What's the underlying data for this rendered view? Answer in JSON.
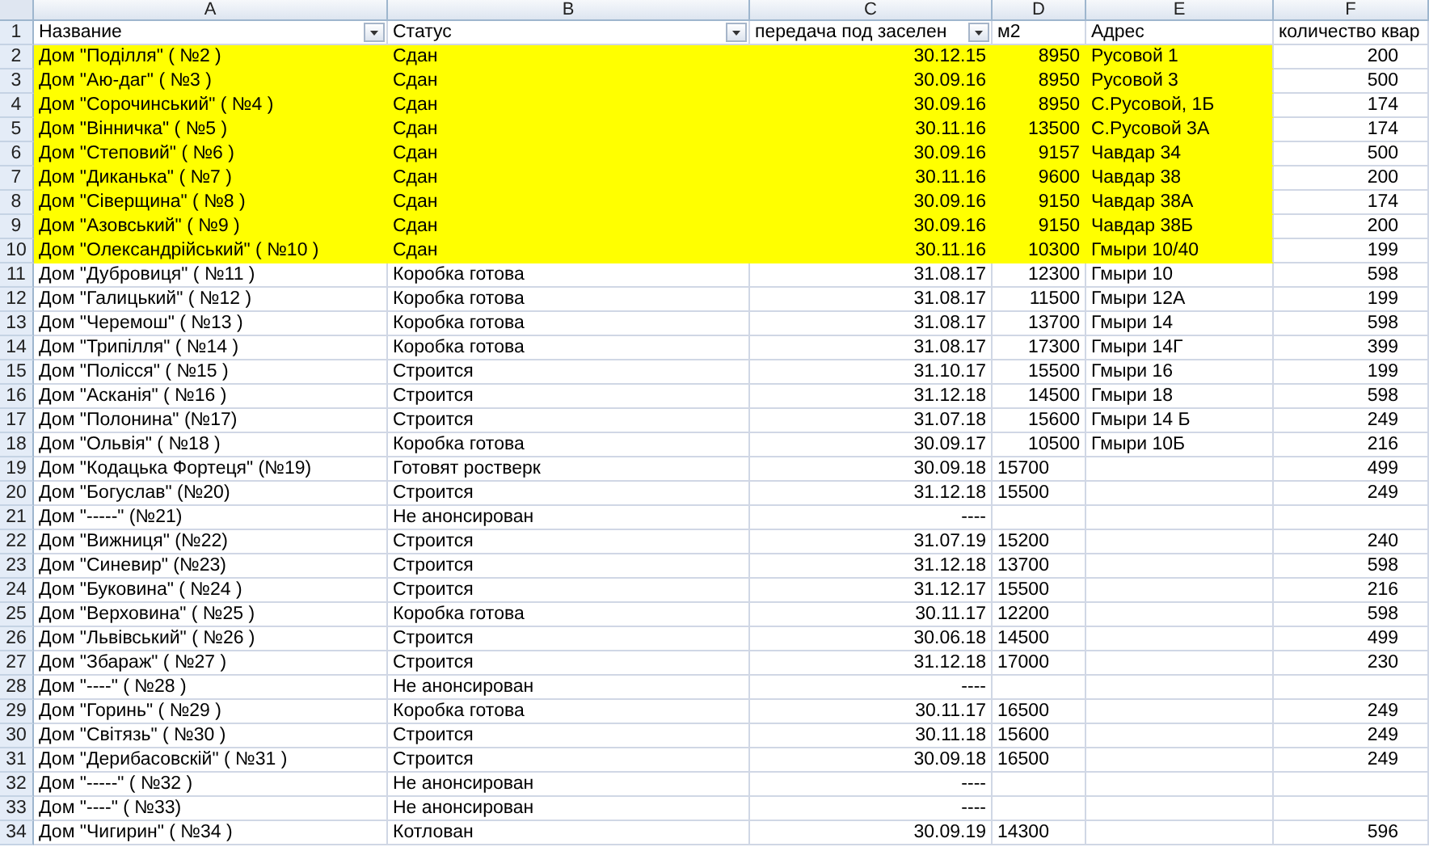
{
  "column_letters": [
    "A",
    "B",
    "C",
    "D",
    "E",
    "F"
  ],
  "header_row": {
    "num": "1",
    "cells": [
      {
        "text": "Название",
        "filter": true
      },
      {
        "text": "Статус",
        "filter": true
      },
      {
        "text": "передача под заселен",
        "filter": true
      },
      {
        "text": "м2",
        "filter": false
      },
      {
        "text": "Адрес",
        "filter": false
      },
      {
        "text": "количество квар",
        "filter": false
      }
    ]
  },
  "rows": [
    {
      "num": "2",
      "name": "Дом \"Поділля\" ( №2 )",
      "status": "Сдан",
      "date": "30.12.15",
      "m2": "8950",
      "m2_text": false,
      "address": "Русовой 1",
      "flats": "200",
      "highlighted": true
    },
    {
      "num": "3",
      "name": "Дом \"Аю-даг\" ( №3 )",
      "status": "Сдан",
      "date": "30.09.16",
      "m2": "8950",
      "m2_text": false,
      "address": "Русовой 3",
      "flats": "500",
      "highlighted": true
    },
    {
      "num": "4",
      "name": "Дом \"Сорочинський\" ( №4 )",
      "status": "Сдан",
      "date": "30.09.16",
      "m2": "8950",
      "m2_text": false,
      "address": "С.Русовой, 1Б",
      "flats": "174",
      "highlighted": true
    },
    {
      "num": "5",
      "name": "Дом \"Вінничка\" ( №5 )",
      "status": "Сдан",
      "date": "30.11.16",
      "m2": "13500",
      "m2_text": false,
      "address": "С.Русовой 3А",
      "flats": "174",
      "highlighted": true
    },
    {
      "num": "6",
      "name": "Дом \"Степовий\" ( №6 )",
      "status": "Сдан",
      "date": "30.09.16",
      "m2": "9157",
      "m2_text": false,
      "address": "Чавдар 34",
      "flats": "500",
      "highlighted": true
    },
    {
      "num": "7",
      "name": "Дом \"Диканька\" ( №7 )",
      "status": "Сдан",
      "date": "30.11.16",
      "m2": "9600",
      "m2_text": false,
      "address": "Чавдар 38",
      "flats": "200",
      "highlighted": true
    },
    {
      "num": "8",
      "name": "Дом \"Сіверщина\" ( №8 )",
      "status": "Сдан",
      "date": "30.09.16",
      "m2": "9150",
      "m2_text": false,
      "address": "Чавдар 38А",
      "flats": "174",
      "highlighted": true
    },
    {
      "num": "9",
      "name": "Дом \"Азовський\" ( №9 )",
      "status": "Сдан",
      "date": "30.09.16",
      "m2": "9150",
      "m2_text": false,
      "address": "Чавдар 38Б",
      "flats": "200",
      "highlighted": true
    },
    {
      "num": "10",
      "name": "Дом \"Олександрійський\" ( №10 )",
      "status": "Сдан",
      "date": "30.11.16",
      "m2": "10300",
      "m2_text": false,
      "address": "Гмыри 10/40",
      "flats": "199",
      "highlighted": true
    },
    {
      "num": "11",
      "name": "Дом \"Дубровиця\" ( №11 )",
      "status": "Коробка готова",
      "date": "31.08.17",
      "m2": "12300",
      "m2_text": false,
      "address": "Гмыри 10",
      "flats": "598",
      "highlighted": false
    },
    {
      "num": "12",
      "name": "Дом \"Галицький\" ( №12 )",
      "status": "Коробка готова",
      "date": "31.08.17",
      "m2": "11500",
      "m2_text": false,
      "address": "Гмыри 12А",
      "flats": "199",
      "highlighted": false
    },
    {
      "num": "13",
      "name": "Дом \"Черемош\" ( №13 )",
      "status": "Коробка готова",
      "date": "31.08.17",
      "m2": "13700",
      "m2_text": false,
      "address": "Гмыри 14",
      "flats": "598",
      "highlighted": false
    },
    {
      "num": "14",
      "name": "Дом \"Трипілля\" ( №14 )",
      "status": "Коробка готова",
      "date": "31.08.17",
      "m2": "17300",
      "m2_text": false,
      "address": "Гмыри 14Г",
      "flats": "399",
      "highlighted": false
    },
    {
      "num": "15",
      "name": "Дом \"Полісся\" ( №15 )",
      "status": "Строится",
      "date": "31.10.17",
      "m2": "15500",
      "m2_text": false,
      "address": "Гмыри 16",
      "flats": "199",
      "highlighted": false
    },
    {
      "num": "16",
      "name": "Дом \"Асканія\" ( №16 )",
      "status": "Строится",
      "date": "31.12.18",
      "m2": "14500",
      "m2_text": false,
      "address": "Гмыри 18",
      "flats": "598",
      "highlighted": false
    },
    {
      "num": "17",
      "name": "Дом \"Полонина\" (№17)",
      "status": "Строится",
      "date": "31.07.18",
      "m2": "15600",
      "m2_text": false,
      "address": "Гмыри 14 Б",
      "flats": "249",
      "highlighted": false
    },
    {
      "num": "18",
      "name": "Дом \"Ольвія\" ( №18 )",
      "status": "Коробка готова",
      "date": "30.09.17",
      "m2": "10500",
      "m2_text": false,
      "address": "Гмыри 10Б",
      "flats": "216",
      "highlighted": false
    },
    {
      "num": "19",
      "name": "Дом \"Кодацька Фортеця\" (№19)",
      "status": "Готовят ростверк",
      "date": "30.09.18",
      "m2": "15700",
      "m2_text": true,
      "flats": "499",
      "highlighted": false
    },
    {
      "num": "20",
      "name": "Дом \"Богуслав\" (№20)",
      "status": "Строится",
      "date": "31.12.18",
      "m2": "15500",
      "m2_text": true,
      "flats": "249",
      "highlighted": false
    },
    {
      "num": "21",
      "name": "Дом \"-----\" (№21)",
      "status": "Не анонсирован",
      "date": "----",
      "highlighted": false
    },
    {
      "num": "22",
      "name": "Дом \"Вижниця\" (№22)",
      "status": "Строится",
      "date": "31.07.19",
      "m2": "15200",
      "m2_text": true,
      "flats": "240",
      "highlighted": false
    },
    {
      "num": "23",
      "name": "Дом \"Синевир\" (№23)",
      "status": "Строится",
      "date": "31.12.18",
      "m2": "13700",
      "m2_text": true,
      "flats": "598",
      "highlighted": false
    },
    {
      "num": "24",
      "name": "Дом \"Буковина\" ( №24 )",
      "status": "Строится",
      "date": "31.12.17",
      "m2": "15500",
      "m2_text": true,
      "flats": "216",
      "highlighted": false
    },
    {
      "num": "25",
      "name": "Дом \"Верховина\" ( №25 )",
      "status": "Коробка готова",
      "date": "30.11.17",
      "m2": "12200",
      "m2_text": true,
      "flats": "598",
      "highlighted": false
    },
    {
      "num": "26",
      "name": "Дом \"Львівський\" ( №26 )",
      "status": "Строится",
      "date": "30.06.18",
      "m2": "14500",
      "m2_text": true,
      "flats": "499",
      "highlighted": false
    },
    {
      "num": "27",
      "name": "Дом \"Збараж\" ( №27 )",
      "status": "Строится",
      "date": "31.12.18",
      "m2": "17000",
      "m2_text": true,
      "flats": "230",
      "highlighted": false
    },
    {
      "num": "28",
      "name": "Дом \"----\" ( №28 )",
      "status": "Не анонсирован",
      "date": "----",
      "highlighted": false
    },
    {
      "num": "29",
      "name": "Дом \"Горинь\" ( №29 )",
      "status": "Коробка готова",
      "date": "30.11.17",
      "m2": "16500",
      "m2_text": true,
      "flats": "249",
      "highlighted": false
    },
    {
      "num": "30",
      "name": "Дом \"Світязь\" ( №30 )",
      "status": "Строится",
      "date": "30.11.18",
      "m2": "15600",
      "m2_text": true,
      "flats": "249",
      "highlighted": false
    },
    {
      "num": "31",
      "name": "Дом \"Дерибасовскій\" ( №31 )",
      "status": "Строится",
      "date": "30.09.18",
      "m2": "16500",
      "m2_text": true,
      "flats": "249",
      "highlighted": false
    },
    {
      "num": "32",
      "name": "Дом \"-----\" ( №32 )",
      "status": "Не анонсирован",
      "date": "----",
      "highlighted": false
    },
    {
      "num": "33",
      "name": "Дом \"----\" ( №33)",
      "status": "Не анонсирован",
      "date": "----",
      "highlighted": false
    },
    {
      "num": "34",
      "name": "Дом \"Чигирин\"  ( №34 )",
      "status": "Котлован",
      "date": "30.09.19",
      "m2": "14300",
      "m2_text": true,
      "flats": "596",
      "highlighted": false
    }
  ]
}
